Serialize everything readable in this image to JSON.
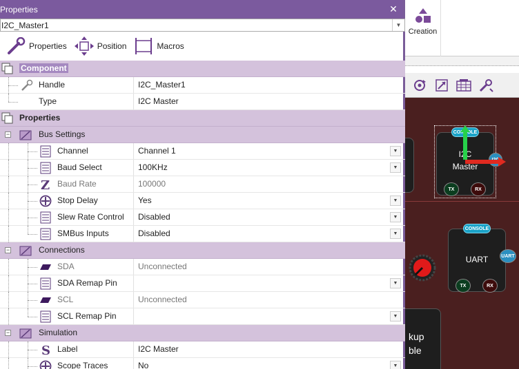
{
  "panel": {
    "title": "Properties",
    "object_selector": "I2C_Master1",
    "tabs": [
      {
        "label": "Properties",
        "icon": "wrench-icon"
      },
      {
        "label": "Position",
        "icon": "move-arrows-icon"
      },
      {
        "label": "Macros",
        "icon": "macros-icon"
      }
    ]
  },
  "component_section": {
    "title": "Component",
    "rows": [
      {
        "name": "Handle",
        "value": "I2C_Master1"
      },
      {
        "name": "Type",
        "value": "I2C Master"
      }
    ]
  },
  "properties_section": {
    "title": "Properties",
    "bus_settings": {
      "title": "Bus Settings",
      "rows": [
        {
          "name": "Channel",
          "value": "Channel 1"
        },
        {
          "name": "Baud Select",
          "value": "100KHz"
        },
        {
          "name": "Baud Rate",
          "value": "100000"
        },
        {
          "name": "Stop Delay",
          "value": "Yes"
        },
        {
          "name": "Slew Rate Control",
          "value": "Disabled"
        },
        {
          "name": "SMBus Inputs",
          "value": "Disabled"
        }
      ]
    },
    "connections": {
      "title": "Connections",
      "rows": [
        {
          "name": "SDA",
          "value": "Unconnected"
        },
        {
          "name": "SDA Remap Pin",
          "value": ""
        },
        {
          "name": "SCL",
          "value": "Unconnected"
        },
        {
          "name": "SCL Remap Pin",
          "value": ""
        }
      ]
    },
    "simulation": {
      "title": "Simulation",
      "rows": [
        {
          "name": "Label",
          "value": "I2C Master"
        },
        {
          "name": "Scope Traces",
          "value": "No"
        }
      ]
    }
  },
  "ribbon": {
    "creation_label": "Creation"
  },
  "canvas": {
    "i2c_block": {
      "line1": "I2C",
      "line2": "Master",
      "console": "CONSOLE",
      "tx": "TX",
      "rx": "RX",
      "pin": "I2C"
    },
    "uart_block": {
      "title": "UART",
      "console": "CONSOLE",
      "tx": "TX",
      "rx": "RX",
      "pin": "UART"
    },
    "partial_block": {
      "line1": "kup",
      "line2": "ble"
    }
  },
  "colors": {
    "panel_title_bg": "#7b5a9e",
    "section_bg": "#d4c2dc",
    "canvas_bg": "#4a1f1f",
    "console_pill": "#1aa3c8"
  }
}
